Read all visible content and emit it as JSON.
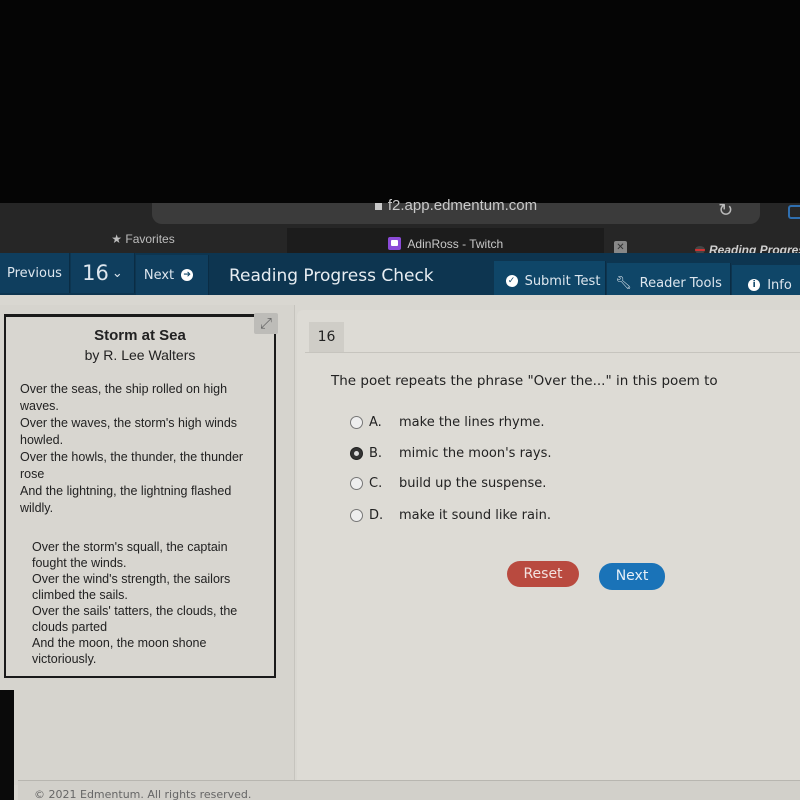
{
  "browser": {
    "url": "f2.app.edmentum.com",
    "tabs": [
      {
        "label": "Favorites",
        "icon": "star-icon"
      },
      {
        "label": "AdinRoss - Twitch",
        "icon": "twitch-icon"
      },
      {
        "label": "Reading Progress",
        "icon": "favicon"
      }
    ],
    "close_glyph": "✕",
    "reload_glyph": "↻"
  },
  "nav": {
    "previous_label": "Previous",
    "question_number": "16",
    "next_label": "Next",
    "title": "Reading Progress Check",
    "submit_label": "Submit Test",
    "reader_tools_label": "Reader Tools",
    "info_label": "Info"
  },
  "passage": {
    "title": "Storm at Sea",
    "author": "by R. Lee Walters",
    "stanzas": [
      [
        "Over the seas, the ship rolled on high waves.",
        "Over the waves, the storm's high winds howled.",
        "Over the howls, the thunder, the thunder rose",
        "And the lightning, the lightning flashed wildly."
      ],
      [
        "Over the storm's squall, the captain fought the winds.",
        "Over the wind's strength, the sailors climbed the sails.",
        "Over the sails' tatters, the clouds, the clouds parted",
        "And the moon, the moon shone victoriously."
      ]
    ]
  },
  "question": {
    "number": "16",
    "prompt": "The poet repeats the phrase \"Over the...\" in this poem to",
    "options": [
      {
        "letter": "A.",
        "text": "make the lines rhyme.",
        "selected": false
      },
      {
        "letter": "B.",
        "text": "mimic the moon's rays.",
        "selected": true
      },
      {
        "letter": "C.",
        "text": "build up the suspense.",
        "selected": false
      },
      {
        "letter": "D.",
        "text": "make it sound like rain.",
        "selected": false
      }
    ],
    "reset_label": "Reset",
    "next_label": "Next"
  },
  "footer": {
    "copyright": "© 2021 Edmentum. All rights reserved."
  },
  "colors": {
    "navbar": "#0d3550",
    "reset": "#b94a3f",
    "next": "#1a73b8"
  }
}
